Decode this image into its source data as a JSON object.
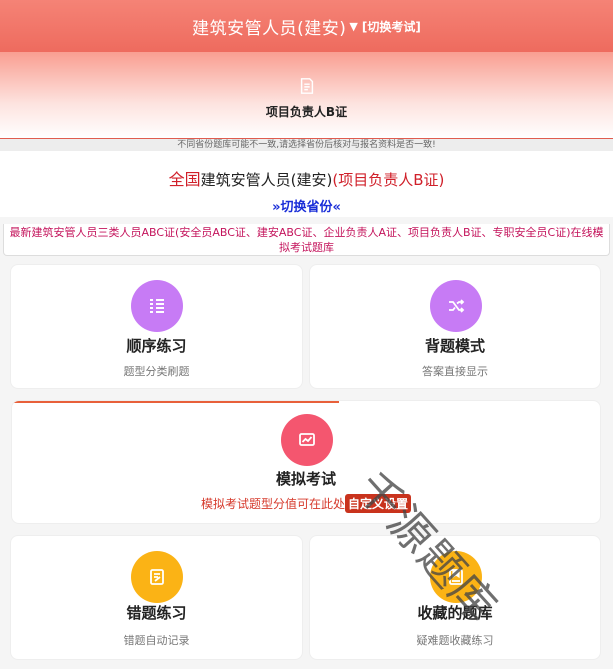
{
  "header": {
    "title": "建筑安管人员(建安)",
    "caret": "▼",
    "switch_exam": "[切换考试]"
  },
  "banner": {
    "subject": "项目负责人B证",
    "icon": "document-icon"
  },
  "notice": "不同省份题库可能不一致,请选择省份后核对与报名资料是否一致!",
  "info": {
    "region": "全国",
    "category": "建筑安管人员(建安)",
    "cert": "(项目负责人B证)",
    "switch_province": "»切换省份«"
  },
  "description": "最新建筑安管人员三类人员ABC证(安全员ABC证、建安ABC证、企业负责人A证、项目负责人B证、专职安全员C证)在线模拟考试题库",
  "cards": [
    {
      "title": "顺序练习",
      "subtitle": "题型分类刷题",
      "icon": "list-icon",
      "color": "#c77bf5"
    },
    {
      "title": "背题模式",
      "subtitle": "答案直接显示",
      "icon": "shuffle-icon",
      "color": "#c77bf5"
    },
    {
      "title": "模拟考试",
      "subtitle": "模拟考试题型分值可在此处",
      "button": "自定义设置",
      "icon": "chart-icon",
      "color": "#f4566f"
    },
    {
      "title": "错题练习",
      "subtitle": "错题自动记录",
      "icon": "edit-icon",
      "color": "#fbb315"
    },
    {
      "title": "收藏的题库",
      "subtitle": "疑难题收藏练习",
      "icon": "bookmark-icon",
      "color": "#fbb315"
    }
  ],
  "watermark": "千源题库"
}
